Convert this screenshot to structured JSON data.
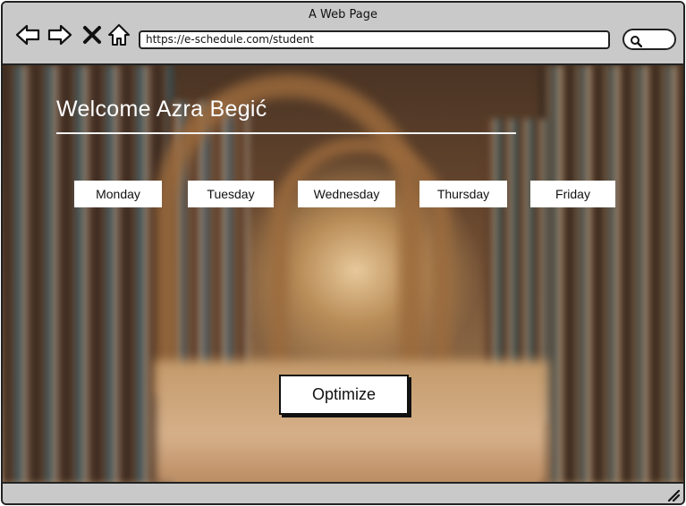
{
  "window": {
    "title": "A Web Page"
  },
  "browser": {
    "url": "https://e-schedule.com/student",
    "icons": [
      "back-icon",
      "forward-icon",
      "close-icon",
      "home-icon",
      "search-icon"
    ]
  },
  "page": {
    "welcome": "Welcome Azra Begić",
    "days": [
      "Monday",
      "Tuesday",
      "Wednesday",
      "Thursday",
      "Friday"
    ],
    "optimize_label": "Optimize"
  },
  "colors": {
    "chrome": "#c9c9c9",
    "border": "#222222",
    "button_bg": "#ffffff",
    "welcome_text": "#ffffff"
  }
}
